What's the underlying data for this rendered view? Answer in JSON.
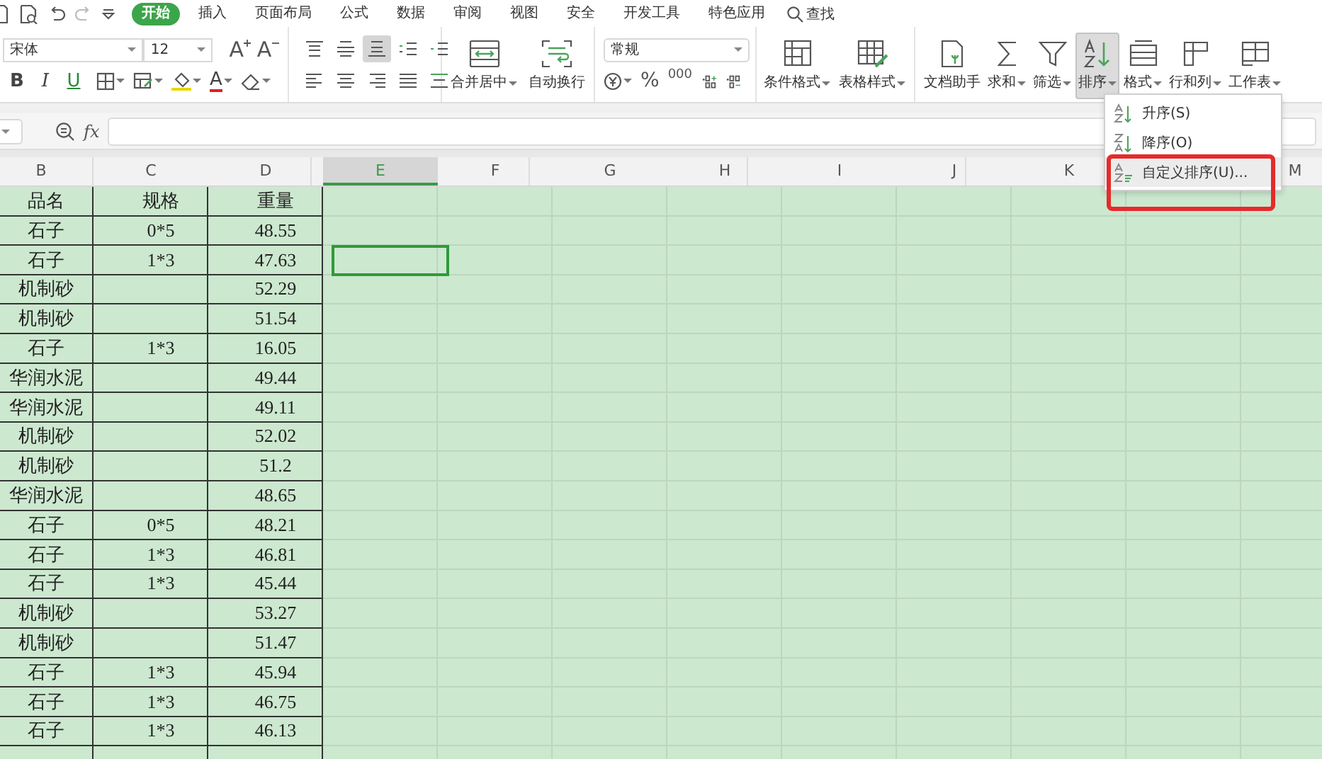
{
  "menu_bar": {
    "tabs": [
      {
        "label": "开始",
        "selected": true
      },
      {
        "label": "插入",
        "selected": false
      },
      {
        "label": "页面布局",
        "selected": false
      },
      {
        "label": "公式",
        "selected": false
      },
      {
        "label": "数据",
        "selected": false
      },
      {
        "label": "审阅",
        "selected": false
      },
      {
        "label": "视图",
        "selected": false
      },
      {
        "label": "安全",
        "selected": false
      },
      {
        "label": "开发工具",
        "selected": false
      },
      {
        "label": "特色应用",
        "selected": false
      }
    ],
    "search": {
      "label": "查找"
    }
  },
  "ribbon": {
    "font_name": "宋体",
    "font_size": "12",
    "grow_font": "A",
    "shrink_font": "A",
    "style_buttons": [
      {
        "label": "B"
      },
      {
        "label": "I"
      },
      {
        "label": "U"
      }
    ],
    "font_color": "A",
    "align_buttons": [
      {
        "pressed": false
      },
      {
        "pressed": false
      },
      {
        "pressed": true
      },
      {
        "pressed": false
      },
      {
        "pressed": false
      },
      {
        "pressed": false
      },
      {
        "pressed": false
      },
      {
        "pressed": false
      },
      {
        "pressed": false
      },
      {
        "pressed": false
      }
    ],
    "merge_buttons": [
      {
        "label": "合并居中",
        "dropdown": true,
        "pressed": false
      },
      {
        "label": "自动换行",
        "dropdown": false,
        "pressed": false
      }
    ],
    "number_format": "常规",
    "number_buttons": [
      {
        "label": "%"
      },
      {
        "label": "000"
      }
    ],
    "format_buttons": [
      {
        "label": "条件格式",
        "dropdown": true,
        "pressed": false
      },
      {
        "label": "表格样式",
        "dropdown": true,
        "pressed": false
      }
    ],
    "tool_buttons": [
      {
        "label": "文档助手",
        "dropdown": false,
        "pressed": false
      },
      {
        "label": "求和",
        "dropdown": true,
        "pressed": false
      },
      {
        "label": "筛选",
        "dropdown": true,
        "pressed": false
      },
      {
        "label": "排序",
        "dropdown": true,
        "pressed": true
      },
      {
        "label": "格式",
        "dropdown": true,
        "pressed": false
      },
      {
        "label": "行和列",
        "dropdown": true,
        "pressed": false
      },
      {
        "label": "工作表",
        "dropdown": true,
        "pressed": false
      }
    ]
  },
  "formula_bar": {
    "function_label": "fx"
  },
  "sheet": {
    "columns": [
      {
        "label": "B",
        "selected": false
      },
      {
        "label": "C",
        "selected": false
      },
      {
        "label": "D",
        "selected": false
      },
      {
        "label": "E",
        "selected": true
      },
      {
        "label": "F",
        "selected": false
      },
      {
        "label": "G",
        "selected": false
      },
      {
        "label": "H",
        "selected": false
      },
      {
        "label": "I",
        "selected": false
      },
      {
        "label": "J",
        "selected": false
      },
      {
        "label": "K",
        "selected": false
      },
      {
        "label": "M",
        "selected": false
      }
    ],
    "rows": [
      {
        "cells": [
          "品名",
          "规格",
          "重量"
        ],
        "has_cursor": false
      },
      {
        "cells": [
          "石子",
          "0*5",
          "48.55"
        ],
        "has_cursor": false
      },
      {
        "cells": [
          "石子",
          "1*3",
          "47.63"
        ],
        "has_cursor": true
      },
      {
        "cells": [
          "机制砂",
          null,
          "52.29"
        ],
        "has_cursor": false
      },
      {
        "cells": [
          "机制砂",
          null,
          "51.54"
        ],
        "has_cursor": false
      },
      {
        "cells": [
          "石子",
          "1*3",
          "16.05"
        ],
        "has_cursor": false
      },
      {
        "cells": [
          "华润水泥",
          null,
          "49.44"
        ],
        "has_cursor": false
      },
      {
        "cells": [
          "华润水泥",
          null,
          "49.11"
        ],
        "has_cursor": false
      },
      {
        "cells": [
          "机制砂",
          null,
          "52.02"
        ],
        "has_cursor": false
      },
      {
        "cells": [
          "机制砂",
          null,
          "51.2"
        ],
        "has_cursor": false
      },
      {
        "cells": [
          "华润水泥",
          null,
          "48.65"
        ],
        "has_cursor": false
      },
      {
        "cells": [
          "石子",
          "0*5",
          "48.21"
        ],
        "has_cursor": false
      },
      {
        "cells": [
          "石子",
          "1*3",
          "46.81"
        ],
        "has_cursor": false
      },
      {
        "cells": [
          "石子",
          "1*3",
          "45.44"
        ],
        "has_cursor": false
      },
      {
        "cells": [
          "机制砂",
          null,
          "53.27"
        ],
        "has_cursor": false
      },
      {
        "cells": [
          "机制砂",
          null,
          "51.47"
        ],
        "has_cursor": false
      },
      {
        "cells": [
          "石子",
          "1*3",
          "45.94"
        ],
        "has_cursor": false
      },
      {
        "cells": [
          "石子",
          "1*3",
          "46.75"
        ],
        "has_cursor": false
      },
      {
        "cells": [
          "石子",
          "1*3",
          "46.13"
        ],
        "has_cursor": false
      }
    ]
  },
  "sort_menu": {
    "items": [
      {
        "label": "升序(S)",
        "selected": false,
        "callout": false
      },
      {
        "label": "降序(O)",
        "selected": false,
        "callout": false
      },
      {
        "label": "自定义排序(U)...",
        "selected": true,
        "callout": true
      }
    ]
  }
}
